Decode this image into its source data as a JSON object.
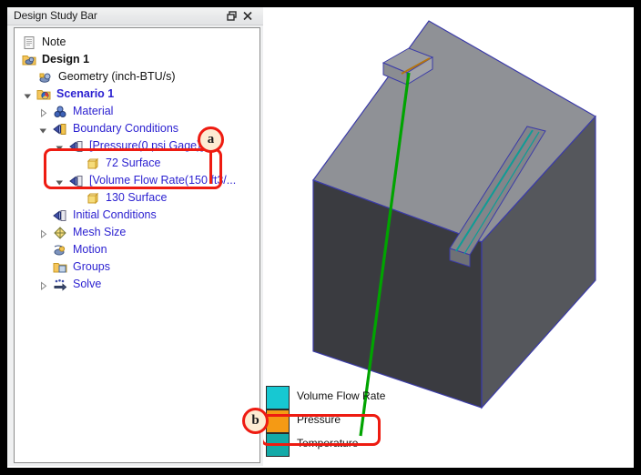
{
  "panel": {
    "title": "Design Study Bar",
    "title_buttons": [
      {
        "name": "restore-icon",
        "label": "Restore"
      },
      {
        "name": "close-icon",
        "label": "Close"
      }
    ],
    "tree": [
      {
        "label": "Note",
        "icon": "note-icon",
        "indent": 0,
        "twisty": "none",
        "style": "black"
      },
      {
        "label": "Design 1",
        "icon": "design-icon",
        "indent": 0,
        "twisty": "none",
        "style": "black-bold"
      },
      {
        "label": "Geometry (inch-BTU/s)",
        "icon": "geometry-icon",
        "indent": 1,
        "twisty": "none",
        "style": "black"
      },
      {
        "label": "Scenario 1",
        "icon": "scenario-icon",
        "indent": 0,
        "twisty": "expanded",
        "style": "link-bold"
      },
      {
        "label": "Material",
        "icon": "material-icon",
        "indent": 1,
        "twisty": "collapsed",
        "style": "link"
      },
      {
        "label": "Boundary Conditions",
        "icon": "bc-icon",
        "indent": 1,
        "twisty": "expanded",
        "style": "link"
      },
      {
        "label": "[Pressure(0 psi Gage)]",
        "icon": "bc-icon",
        "indent": 2,
        "twisty": "expanded",
        "style": "link"
      },
      {
        "label": "72 Surface",
        "icon": "surface-icon",
        "indent": 3,
        "twisty": "none",
        "style": "link"
      },
      {
        "label": "[Volume Flow Rate(150 ft3/...",
        "icon": "bc-icon",
        "indent": 2,
        "twisty": "expanded",
        "style": "link"
      },
      {
        "label": "130 Surface",
        "icon": "surface-icon",
        "indent": 3,
        "twisty": "none",
        "style": "link"
      },
      {
        "label": "Initial Conditions",
        "icon": "ic-icon",
        "indent": 1,
        "twisty": "none",
        "style": "link"
      },
      {
        "label": "Mesh Size",
        "icon": "mesh-icon",
        "indent": 1,
        "twisty": "collapsed",
        "style": "link"
      },
      {
        "label": "Motion",
        "icon": "motion-icon",
        "indent": 1,
        "twisty": "none",
        "style": "link"
      },
      {
        "label": "Groups",
        "icon": "groups-icon",
        "indent": 1,
        "twisty": "none",
        "style": "link"
      },
      {
        "label": "Solve",
        "icon": "solve-icon",
        "indent": 1,
        "twisty": "collapsed",
        "style": "link"
      }
    ]
  },
  "annotations": {
    "accent_color": "#ee1b11",
    "badge_fill": "#fdecd2",
    "callouts": [
      {
        "id": "a",
        "label": "a",
        "target": "pressure-boundary-condition-group"
      },
      {
        "id": "b",
        "label": "b",
        "target": "legend-pressure-row"
      }
    ]
  },
  "legend": {
    "items": [
      {
        "label": "Volume Flow Rate",
        "color": "#17c8d2"
      },
      {
        "label": "Pressure",
        "color": "#f59a14"
      },
      {
        "label": "Temperature",
        "color": "#13aaa8"
      }
    ]
  },
  "viewport": {
    "model_name": "solid-box-model",
    "body_color": "#8a8c91",
    "top_face_color": "#8f9196",
    "front_face_color": "#3a3b40",
    "side_face_color": "#55575c",
    "edge_color": "#3b3ba8",
    "probe_line_color": "#00a400",
    "pressure_feature_color": "#b4740e",
    "flow_feature_color": "#0f9c96"
  }
}
